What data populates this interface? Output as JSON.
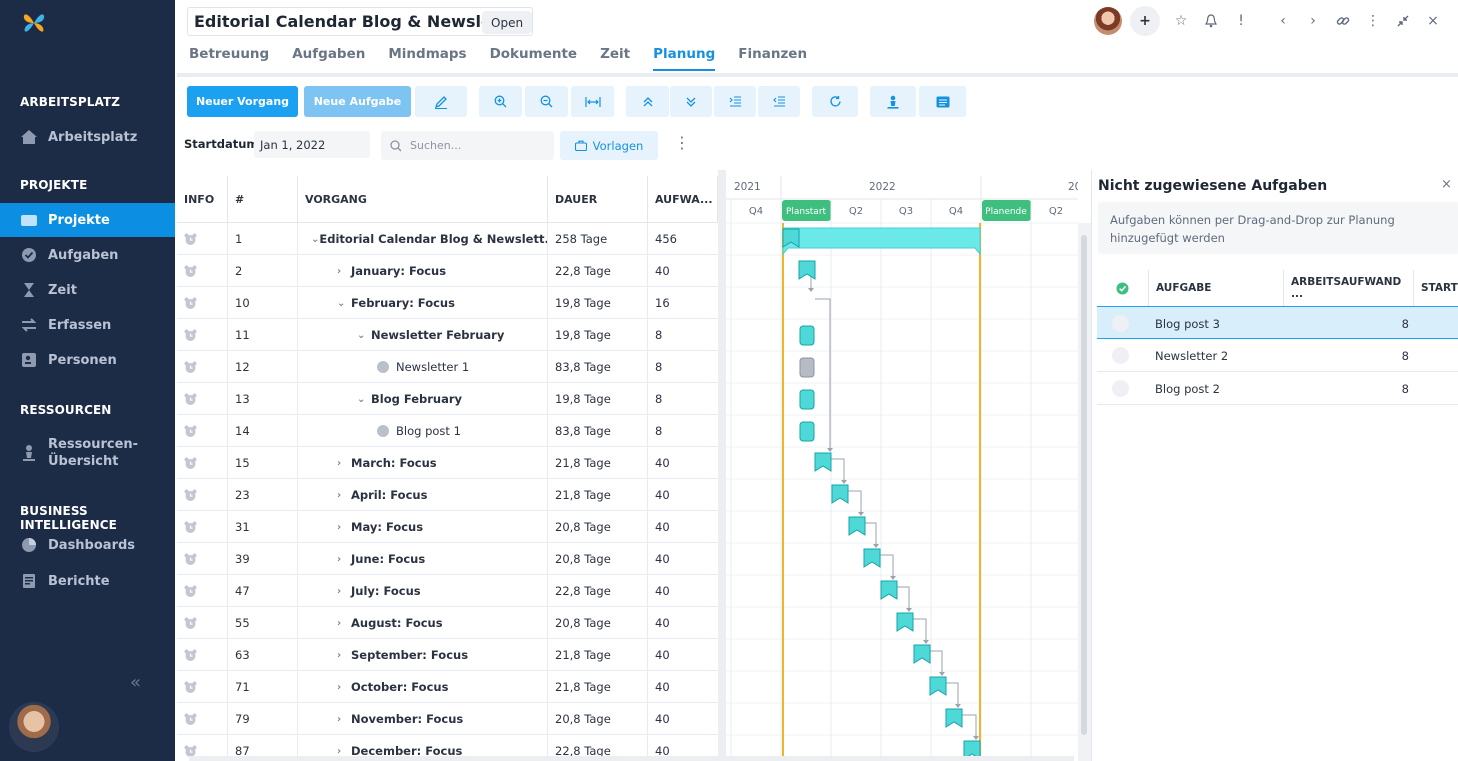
{
  "sidebar": {
    "sections": [
      "ARBEITSPLATZ",
      "PROJEKTE",
      "RESSOURCEN",
      "BUSINESS INTELLIGENCE"
    ],
    "items": {
      "arbeitsplatz": "Arbeitsplatz",
      "projekte": "Projekte",
      "aufgaben": "Aufgaben",
      "zeit": "Zeit",
      "erfassen": "Erfassen",
      "personen": "Personen",
      "ressourcen_line1": "Ressourcen-",
      "ressourcen_line2": "Übersicht",
      "dashboards": "Dashboards",
      "berichte": "Berichte"
    },
    "collapse": "«"
  },
  "header": {
    "title": "Editorial Calendar Blog & Newsletter",
    "status": "Open",
    "plus": "+",
    "star": "☆",
    "bell": "🔔",
    "alert": "!",
    "prev": "‹",
    "next": "›",
    "link": "🔗",
    "menu": "⋮",
    "shrink": "⤡",
    "close": "×"
  },
  "tabs": [
    "Betreuung",
    "Aufgaben",
    "Mindmaps",
    "Dokumente",
    "Zeit",
    "Planung",
    "Finanzen"
  ],
  "toolbar": {
    "new_process": "Neuer Vorgang",
    "new_task": "Neue Aufgabe"
  },
  "filters": {
    "start_label": "Startdatum:",
    "start_value": "Jan 1, 2022",
    "search_placeholder": "Suchen...",
    "templates": "Vorlagen"
  },
  "grid": {
    "headers": [
      "INFO",
      "#",
      "VORGANG",
      "DAUER",
      "AUFWA..."
    ],
    "rows": [
      {
        "id": "1",
        "name": "Editorial Calendar Blog & Newslett...",
        "duration": "258 Tage",
        "effort": "456",
        "level": 0,
        "chev": "down",
        "bold": true
      },
      {
        "id": "2",
        "name": "January: Focus",
        "duration": "22,8 Tage",
        "effort": "40",
        "level": 1,
        "chev": "right",
        "bold": true
      },
      {
        "id": "10",
        "name": "February: Focus",
        "duration": "19,8 Tage",
        "effort": "16",
        "level": 1,
        "chev": "down",
        "bold": true
      },
      {
        "id": "11",
        "name": "Newsletter February",
        "duration": "19,8 Tage",
        "effort": "8",
        "level": 2,
        "chev": "down",
        "bold": true
      },
      {
        "id": "12",
        "name": "Newsletter 1",
        "duration": "83,8 Tage",
        "effort": "8",
        "level": 3,
        "chev": "leaf",
        "bold": false
      },
      {
        "id": "13",
        "name": "Blog February",
        "duration": "19,8 Tage",
        "effort": "8",
        "level": 2,
        "chev": "down",
        "bold": true
      },
      {
        "id": "14",
        "name": "Blog post 1",
        "duration": "83,8 Tage",
        "effort": "8",
        "level": 3,
        "chev": "leaf",
        "bold": false
      },
      {
        "id": "15",
        "name": "March: Focus",
        "duration": "21,8 Tage",
        "effort": "40",
        "level": 1,
        "chev": "right",
        "bold": true
      },
      {
        "id": "23",
        "name": "April: Focus",
        "duration": "21,8 Tage",
        "effort": "40",
        "level": 1,
        "chev": "right",
        "bold": true
      },
      {
        "id": "31",
        "name": "May: Focus",
        "duration": "20,8 Tage",
        "effort": "40",
        "level": 1,
        "chev": "right",
        "bold": true
      },
      {
        "id": "39",
        "name": "June: Focus",
        "duration": "20,8 Tage",
        "effort": "40",
        "level": 1,
        "chev": "right",
        "bold": true
      },
      {
        "id": "47",
        "name": "July: Focus",
        "duration": "22,8 Tage",
        "effort": "40",
        "level": 1,
        "chev": "right",
        "bold": true
      },
      {
        "id": "55",
        "name": "August: Focus",
        "duration": "20,8 Tage",
        "effort": "40",
        "level": 1,
        "chev": "right",
        "bold": true
      },
      {
        "id": "63",
        "name": "September: Focus",
        "duration": "21,8 Tage",
        "effort": "40",
        "level": 1,
        "chev": "right",
        "bold": true
      },
      {
        "id": "71",
        "name": "October: Focus",
        "duration": "21,8 Tage",
        "effort": "40",
        "level": 1,
        "chev": "right",
        "bold": true
      },
      {
        "id": "79",
        "name": "November: Focus",
        "duration": "20,8 Tage",
        "effort": "40",
        "level": 1,
        "chev": "right",
        "bold": true
      },
      {
        "id": "87",
        "name": "December: Focus",
        "duration": "22,8 Tage",
        "effort": "40",
        "level": 1,
        "chev": "right",
        "bold": true
      }
    ]
  },
  "gantt": {
    "years": [
      "2021",
      "2022",
      "20"
    ],
    "quarters": [
      "Q4",
      "Planstart",
      "Q2",
      "Q3",
      "Q4",
      "Planende",
      "Q2"
    ],
    "colors": {
      "task": "#4fd8d8",
      "task_border": "#17a3a8",
      "task_gray": "#b6bcc6",
      "plan_line": "#f0b429",
      "marker": "#3fbf7f"
    }
  },
  "panel": {
    "title": "Nicht zugewiesene Aufgaben",
    "close": "×",
    "hint": "Aufgaben können per Drag-and-Drop zur Planung hinzugefügt werden",
    "headers": [
      "AUFGABE",
      "ARBEITSAUFWAND ...",
      "START"
    ],
    "rows": [
      {
        "name": "Blog post 3",
        "effort": "8",
        "selected": true
      },
      {
        "name": "Newsletter 2",
        "effort": "8",
        "selected": false
      },
      {
        "name": "Blog post 2",
        "effort": "8",
        "selected": false
      }
    ]
  }
}
